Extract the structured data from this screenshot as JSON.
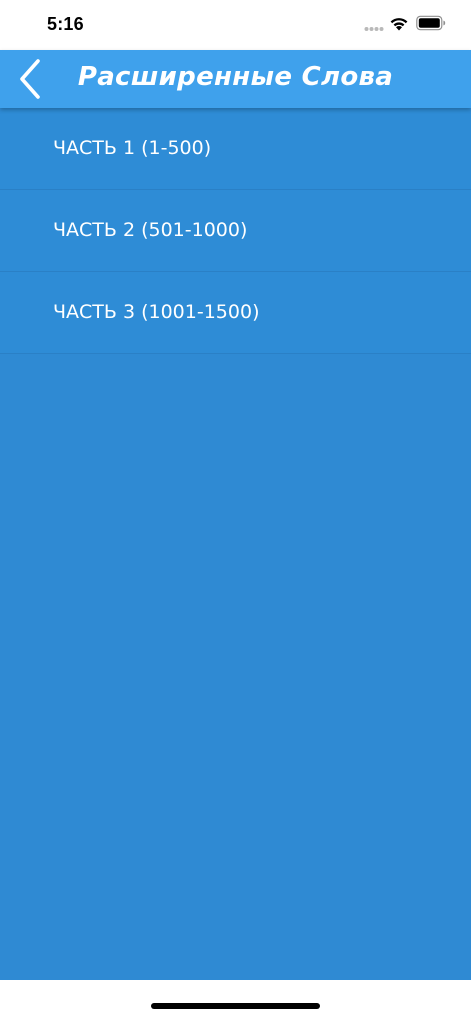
{
  "status_bar": {
    "time": "5:16"
  },
  "nav": {
    "title": "Расширенные Слова",
    "back_icon": "chevron-left-icon",
    "color": "#3fa1ec"
  },
  "list": {
    "background_color": "#2e8cd6",
    "items": [
      {
        "label": "ЧАСТЬ 1 (1-500)"
      },
      {
        "label": "ЧАСТЬ 2 (501-1000)"
      },
      {
        "label": "ЧАСТЬ 3 (1001-1500)"
      }
    ]
  }
}
